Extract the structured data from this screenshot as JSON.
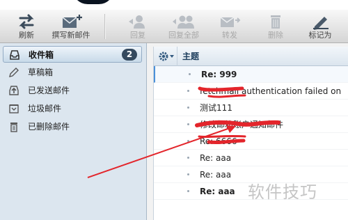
{
  "toolbar": {
    "buttons": [
      {
        "label": "刷新",
        "icon": "refresh-icon",
        "enabled": true
      },
      {
        "label": "撰写新邮件",
        "icon": "compose-mail-icon",
        "enabled": true
      },
      {
        "label": "回复",
        "icon": "reply-icon",
        "enabled": false
      },
      {
        "label": "回复全部",
        "icon": "reply-all-icon",
        "enabled": false
      },
      {
        "label": "转发",
        "icon": "forward-icon",
        "enabled": false
      },
      {
        "label": "删除",
        "icon": "trash-icon",
        "enabled": false
      },
      {
        "label": "标记为",
        "icon": "mark-as-icon",
        "enabled": true
      }
    ]
  },
  "sidebar": {
    "folders": [
      {
        "label": "收件箱",
        "icon": "inbox-icon",
        "count": "2",
        "active": true
      },
      {
        "label": "草稿箱",
        "icon": "pencil-icon",
        "active": false
      },
      {
        "label": "已发送邮件",
        "icon": "sent-icon",
        "active": false
      },
      {
        "label": "垃圾邮件",
        "icon": "junk-icon",
        "active": false
      },
      {
        "label": "已删除邮件",
        "icon": "trash-icon",
        "active": false
      }
    ]
  },
  "message_list": {
    "subject_header": "主题",
    "settings_icon": "gear-icon",
    "rows": [
      {
        "subject": "Re: 999",
        "unread": true
      },
      {
        "subject": "fetchmail authentication failed on",
        "unread": false
      },
      {
        "subject": "测试111",
        "unread": false
      },
      {
        "subject": "修改邮箱账户通知邮件",
        "unread": false
      },
      {
        "subject": "Re: 6666",
        "unread": false
      },
      {
        "subject": "Re: aaa",
        "unread": false
      },
      {
        "subject": "Re: aaa",
        "unread": false
      },
      {
        "subject": "Re: aaa",
        "unread": true
      }
    ]
  },
  "colors": {
    "annotation": "#e3252b",
    "count_badge": "#34495e",
    "sidebar_bg": "#dce6ef"
  },
  "watermark": "软件技巧"
}
